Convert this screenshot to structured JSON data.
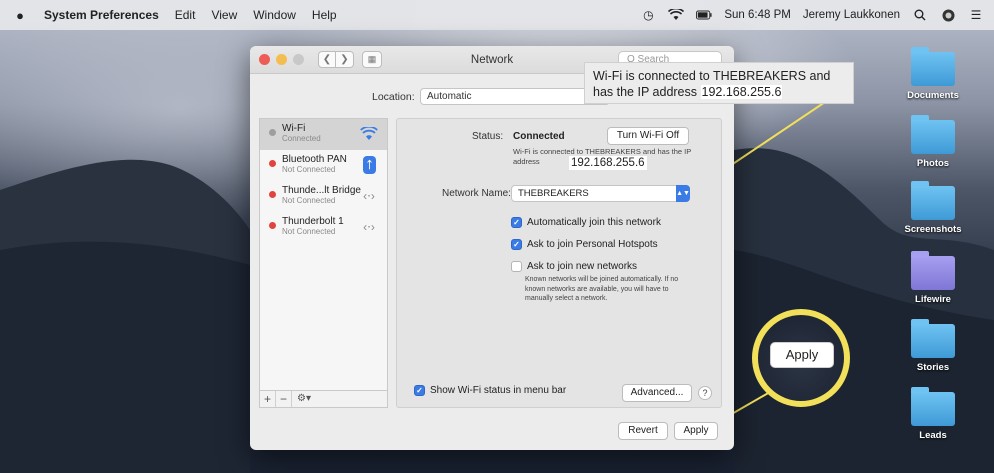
{
  "menubar": {
    "app_name": "System Preferences",
    "items": [
      "Edit",
      "View",
      "Window",
      "Help"
    ],
    "clock": "Sun 6:48 PM",
    "user": "Jeremy Laukkonen"
  },
  "desktop_icons": [
    "Documents",
    "Photos",
    "Screenshots",
    "Lifewire",
    "Stories",
    "Leads"
  ],
  "window": {
    "title": "Network",
    "search_placeholder": "Q Search",
    "location_label": "Location:",
    "location_value": "Automatic",
    "services": [
      {
        "name": "Wi-Fi",
        "status": "Connected"
      },
      {
        "name": "Bluetooth PAN",
        "status": "Not Connected"
      },
      {
        "name": "Thunde...lt Bridge",
        "status": "Not Connected"
      },
      {
        "name": "Thunderbolt 1",
        "status": "Not Connected"
      }
    ],
    "status_label": "Status:",
    "status_value": "Connected",
    "turn_off_label": "Turn Wi-Fi Off",
    "status_desc": "Wi-Fi is connected to THEBREAKERS and has the IP address",
    "ip_address": "192.168.255.6",
    "network_name_label": "Network Name:",
    "network_name_value": "THEBREAKERS",
    "auto_join_label": "Automatically join this network",
    "ask_hotspots_label": "Ask to join Personal Hotspots",
    "ask_new_label": "Ask to join new networks",
    "ask_new_hint": "Known networks will be joined automatically. If no known networks are available, you will have to manually select a network.",
    "show_status_label": "Show Wi-Fi status in menu bar",
    "advanced_label": "Advanced...",
    "help_label": "?",
    "revert_label": "Revert",
    "apply_label": "Apply"
  },
  "callouts": {
    "status_text": "Wi-Fi is connected to THEBREAKERS and has the IP address",
    "ip_address": "192.168.255.6",
    "apply_label": "Apply"
  },
  "colors": {
    "accent": "#3a7be6",
    "callout": "#f2e05a",
    "disconnected": "#e0443e"
  }
}
